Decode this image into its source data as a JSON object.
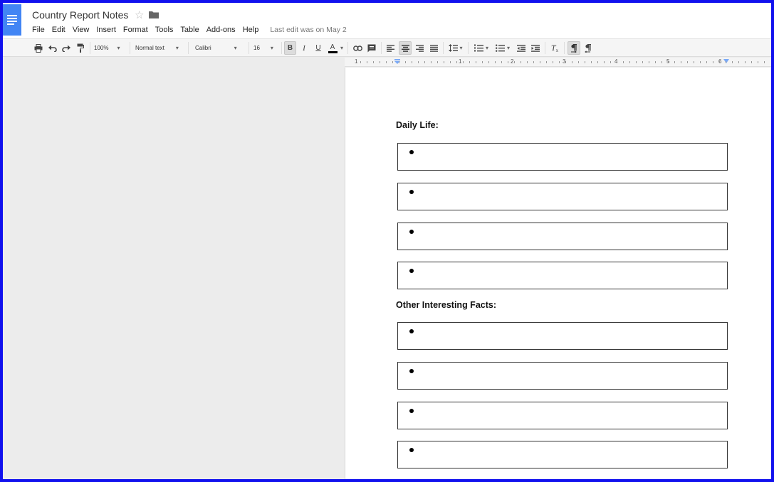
{
  "document": {
    "title": "Country Report Notes",
    "last_edit": "Last edit was on May 2"
  },
  "menu": [
    "File",
    "Edit",
    "View",
    "Insert",
    "Format",
    "Tools",
    "Table",
    "Add-ons",
    "Help"
  ],
  "toolbar": {
    "zoom": "100%",
    "style": "Normal text",
    "font": "Calibri",
    "font_size": "16",
    "bold_label": "B",
    "italic_label": "I",
    "underline_label": "U",
    "text_color_label": "A",
    "text_color": "#000000",
    "active_alignment": "center"
  },
  "ruler": {
    "numbers": [
      "1",
      "1",
      "2",
      "3",
      "4",
      "5",
      "6"
    ]
  },
  "page": {
    "sections": [
      {
        "heading": "Daily Life:",
        "bullet_boxes": 4
      },
      {
        "heading": "Other Interesting Facts:",
        "bullet_boxes": 4
      }
    ]
  },
  "colors": {
    "frame_border": "#1111ee",
    "docs_blue": "#4285f4",
    "page_background": "#ececec"
  }
}
